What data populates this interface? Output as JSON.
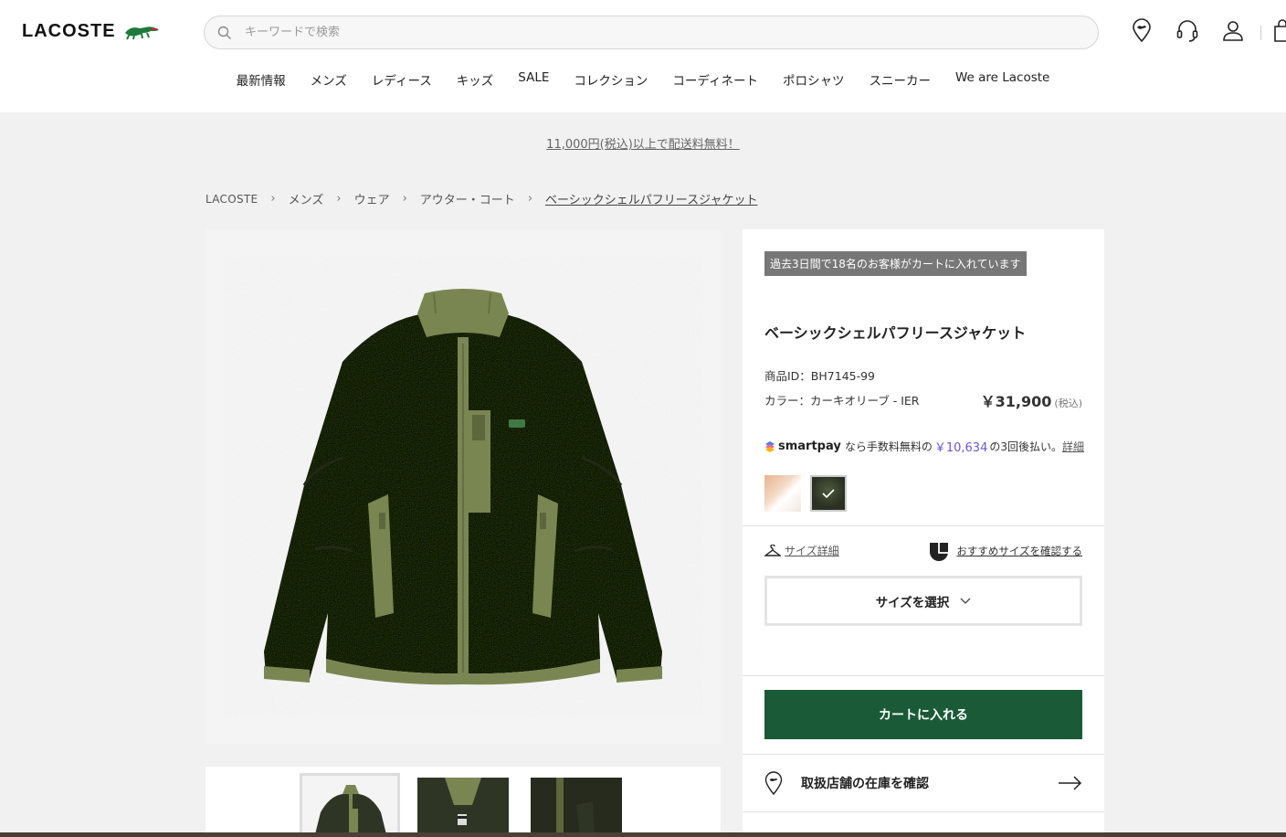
{
  "header": {
    "logo_text": "LACOSTE",
    "search_placeholder": "キーワードで検索",
    "icons": [
      "store-locator-icon",
      "support-headset-icon",
      "account-icon",
      "bag-icon"
    ]
  },
  "nav": [
    "最新情報",
    "メンズ",
    "レディース",
    "キッズ",
    "SALE",
    "コレクション",
    "コーディネート",
    "ポロシャツ",
    "スニーカー",
    "We are Lacoste"
  ],
  "banner": "11,000円(税込)以上で配送料無料！",
  "breadcrumb": [
    "LACOSTE",
    "メンズ",
    "ウェア",
    "アウター・コート",
    "ベーシックシェルパフリースジャケット"
  ],
  "product": {
    "badge": "過去3日間で18名のお客様がカートに入れています",
    "title": "ベーシックシェルパフリースジャケット",
    "id_line": "商品ID：BH7145-99",
    "color_line": "カラー：カーキオリーブ - IER",
    "price": "￥31,900",
    "price_tax": "(税込)",
    "smartpay": {
      "logo": "smartpay",
      "text_before": "なら手数料無料の",
      "amount": "￥10,634",
      "text_after": "の3回後払い。",
      "link": "詳細"
    },
    "swatches": [
      {
        "name": "beige",
        "selected": false
      },
      {
        "name": "khaki-olive",
        "selected": true
      }
    ],
    "size_guide": "サイズ詳細",
    "size_recommend": "おすすめサイズを確認する",
    "size_select": "サイズを選択",
    "add_to_cart": "カートに入れる",
    "store_stock": "取扱店舗の在庫を確認"
  },
  "colors": {
    "brand_green": "#1a5a37",
    "jacket_body": "#2f3525",
    "jacket_trim": "#7a8652",
    "smartpay_accent": "#6b55d6"
  }
}
